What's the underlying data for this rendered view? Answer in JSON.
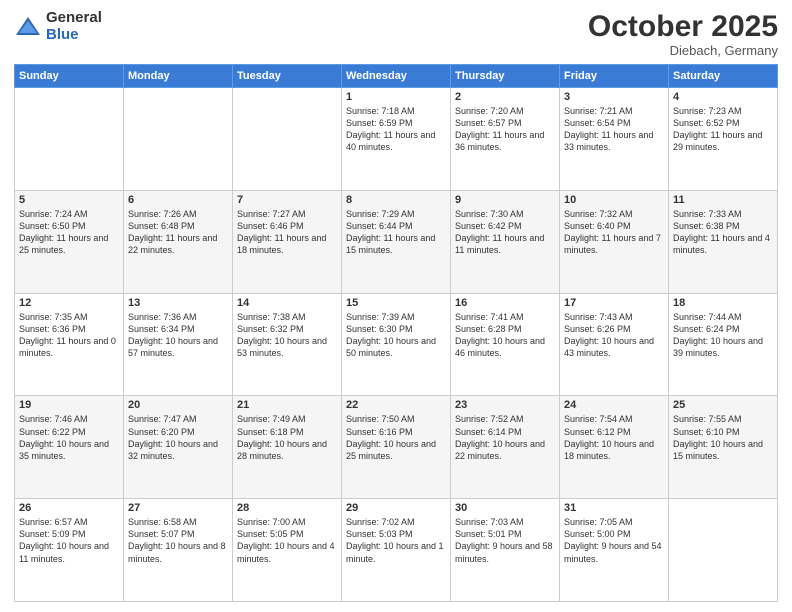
{
  "header": {
    "logo_general": "General",
    "logo_blue": "Blue",
    "month_title": "October 2025",
    "subtitle": "Diebach, Germany"
  },
  "days_of_week": [
    "Sunday",
    "Monday",
    "Tuesday",
    "Wednesday",
    "Thursday",
    "Friday",
    "Saturday"
  ],
  "weeks": [
    [
      {
        "day": "",
        "info": ""
      },
      {
        "day": "",
        "info": ""
      },
      {
        "day": "",
        "info": ""
      },
      {
        "day": "1",
        "info": "Sunrise: 7:18 AM\nSunset: 6:59 PM\nDaylight: 11 hours and 40 minutes."
      },
      {
        "day": "2",
        "info": "Sunrise: 7:20 AM\nSunset: 6:57 PM\nDaylight: 11 hours and 36 minutes."
      },
      {
        "day": "3",
        "info": "Sunrise: 7:21 AM\nSunset: 6:54 PM\nDaylight: 11 hours and 33 minutes."
      },
      {
        "day": "4",
        "info": "Sunrise: 7:23 AM\nSunset: 6:52 PM\nDaylight: 11 hours and 29 minutes."
      }
    ],
    [
      {
        "day": "5",
        "info": "Sunrise: 7:24 AM\nSunset: 6:50 PM\nDaylight: 11 hours and 25 minutes."
      },
      {
        "day": "6",
        "info": "Sunrise: 7:26 AM\nSunset: 6:48 PM\nDaylight: 11 hours and 22 minutes."
      },
      {
        "day": "7",
        "info": "Sunrise: 7:27 AM\nSunset: 6:46 PM\nDaylight: 11 hours and 18 minutes."
      },
      {
        "day": "8",
        "info": "Sunrise: 7:29 AM\nSunset: 6:44 PM\nDaylight: 11 hours and 15 minutes."
      },
      {
        "day": "9",
        "info": "Sunrise: 7:30 AM\nSunset: 6:42 PM\nDaylight: 11 hours and 11 minutes."
      },
      {
        "day": "10",
        "info": "Sunrise: 7:32 AM\nSunset: 6:40 PM\nDaylight: 11 hours and 7 minutes."
      },
      {
        "day": "11",
        "info": "Sunrise: 7:33 AM\nSunset: 6:38 PM\nDaylight: 11 hours and 4 minutes."
      }
    ],
    [
      {
        "day": "12",
        "info": "Sunrise: 7:35 AM\nSunset: 6:36 PM\nDaylight: 11 hours and 0 minutes."
      },
      {
        "day": "13",
        "info": "Sunrise: 7:36 AM\nSunset: 6:34 PM\nDaylight: 10 hours and 57 minutes."
      },
      {
        "day": "14",
        "info": "Sunrise: 7:38 AM\nSunset: 6:32 PM\nDaylight: 10 hours and 53 minutes."
      },
      {
        "day": "15",
        "info": "Sunrise: 7:39 AM\nSunset: 6:30 PM\nDaylight: 10 hours and 50 minutes."
      },
      {
        "day": "16",
        "info": "Sunrise: 7:41 AM\nSunset: 6:28 PM\nDaylight: 10 hours and 46 minutes."
      },
      {
        "day": "17",
        "info": "Sunrise: 7:43 AM\nSunset: 6:26 PM\nDaylight: 10 hours and 43 minutes."
      },
      {
        "day": "18",
        "info": "Sunrise: 7:44 AM\nSunset: 6:24 PM\nDaylight: 10 hours and 39 minutes."
      }
    ],
    [
      {
        "day": "19",
        "info": "Sunrise: 7:46 AM\nSunset: 6:22 PM\nDaylight: 10 hours and 35 minutes."
      },
      {
        "day": "20",
        "info": "Sunrise: 7:47 AM\nSunset: 6:20 PM\nDaylight: 10 hours and 32 minutes."
      },
      {
        "day": "21",
        "info": "Sunrise: 7:49 AM\nSunset: 6:18 PM\nDaylight: 10 hours and 28 minutes."
      },
      {
        "day": "22",
        "info": "Sunrise: 7:50 AM\nSunset: 6:16 PM\nDaylight: 10 hours and 25 minutes."
      },
      {
        "day": "23",
        "info": "Sunrise: 7:52 AM\nSunset: 6:14 PM\nDaylight: 10 hours and 22 minutes."
      },
      {
        "day": "24",
        "info": "Sunrise: 7:54 AM\nSunset: 6:12 PM\nDaylight: 10 hours and 18 minutes."
      },
      {
        "day": "25",
        "info": "Sunrise: 7:55 AM\nSunset: 6:10 PM\nDaylight: 10 hours and 15 minutes."
      }
    ],
    [
      {
        "day": "26",
        "info": "Sunrise: 6:57 AM\nSunset: 5:09 PM\nDaylight: 10 hours and 11 minutes."
      },
      {
        "day": "27",
        "info": "Sunrise: 6:58 AM\nSunset: 5:07 PM\nDaylight: 10 hours and 8 minutes."
      },
      {
        "day": "28",
        "info": "Sunrise: 7:00 AM\nSunset: 5:05 PM\nDaylight: 10 hours and 4 minutes."
      },
      {
        "day": "29",
        "info": "Sunrise: 7:02 AM\nSunset: 5:03 PM\nDaylight: 10 hours and 1 minute."
      },
      {
        "day": "30",
        "info": "Sunrise: 7:03 AM\nSunset: 5:01 PM\nDaylight: 9 hours and 58 minutes."
      },
      {
        "day": "31",
        "info": "Sunrise: 7:05 AM\nSunset: 5:00 PM\nDaylight: 9 hours and 54 minutes."
      },
      {
        "day": "",
        "info": ""
      }
    ]
  ]
}
